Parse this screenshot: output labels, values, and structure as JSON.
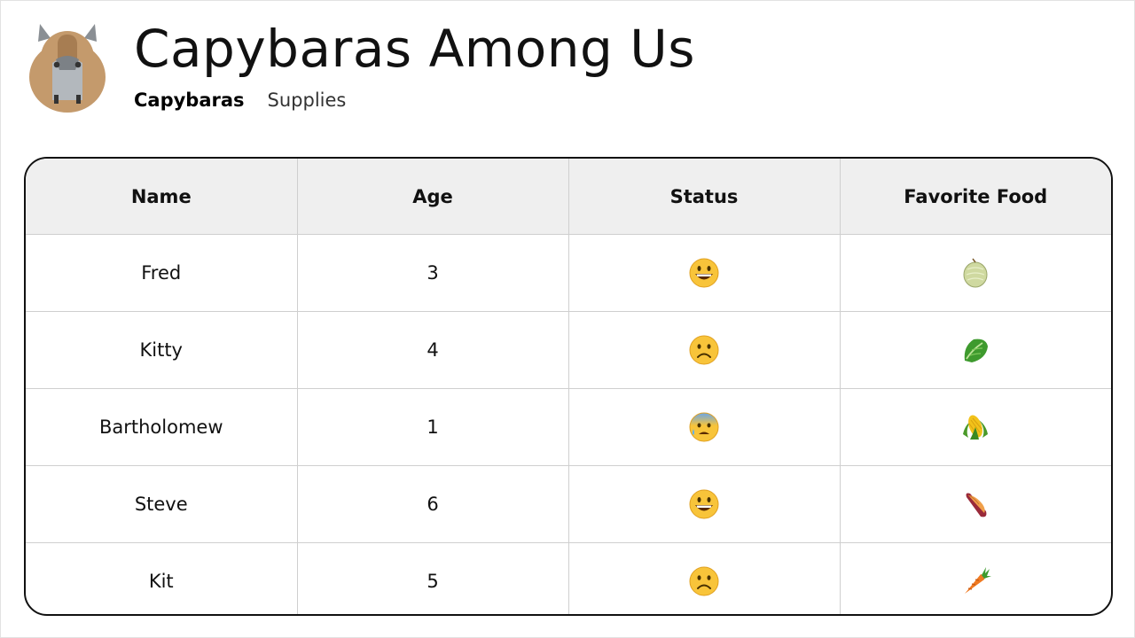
{
  "header": {
    "title": "Capybaras Among Us",
    "nav": [
      {
        "label": "Capybaras",
        "active": true
      },
      {
        "label": "Supplies",
        "active": false
      }
    ]
  },
  "table": {
    "columns": [
      "Name",
      "Age",
      "Status",
      "Favorite Food"
    ],
    "rows": [
      {
        "name": "Fred",
        "age": "3",
        "status_icon": "grinning-face-icon",
        "food_icon": "melon-icon"
      },
      {
        "name": "Kitty",
        "age": "4",
        "status_icon": "frowning-face-icon",
        "food_icon": "leafy-green-icon"
      },
      {
        "name": "Bartholomew",
        "age": "1",
        "status_icon": "anxious-sweat-face-icon",
        "food_icon": "corn-icon"
      },
      {
        "name": "Steve",
        "age": "6",
        "status_icon": "grinning-face-icon",
        "food_icon": "sweet-potato-icon"
      },
      {
        "name": "Kit",
        "age": "5",
        "status_icon": "frowning-face-icon",
        "food_icon": "carrot-icon"
      }
    ]
  },
  "colors": {
    "header_bg": "#efefef",
    "capybara_fur": "#c49a6c",
    "capybara_mask": "#b0b5ba"
  }
}
